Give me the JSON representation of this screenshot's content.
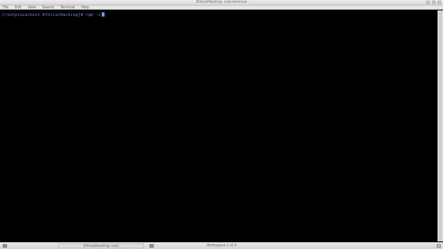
{
  "window": {
    "title": "EthicalHacking: root-terminal"
  },
  "menubar": {
    "items": [
      "File",
      "Edit",
      "View",
      "Search",
      "Terminal",
      "Help"
    ]
  },
  "terminal": {
    "prompt": "[root@localhost EthicalHacking]# ",
    "command": "rpm -i",
    "text_color": "#6f9cf0",
    "background": "#000000"
  },
  "taskbar": {
    "window_button_label": "EthicalHacking: root",
    "workspace_label": "Workspace 1 of 4"
  }
}
